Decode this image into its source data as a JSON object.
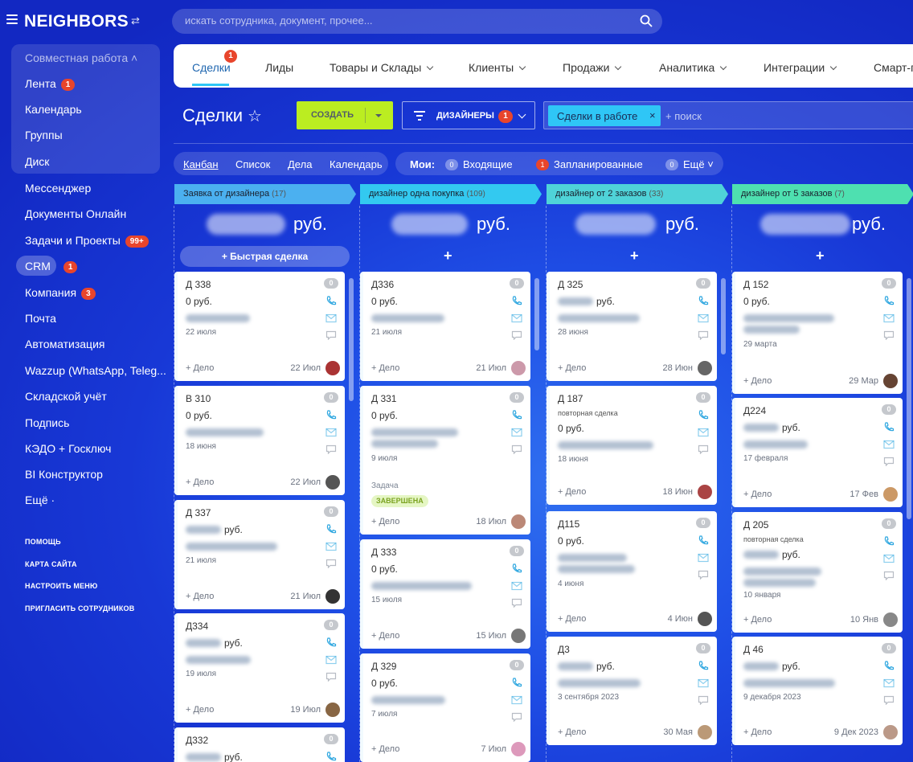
{
  "app": {
    "logo": "NEIGHBORS",
    "swap_icon": "swap-icon"
  },
  "search": {
    "placeholder": "искать сотрудника, документ, прочее..."
  },
  "sidebar": {
    "group": "Совместная работа",
    "items": [
      {
        "label": "Лента",
        "badge": "1"
      },
      {
        "label": "Календарь"
      },
      {
        "label": "Группы"
      },
      {
        "label": "Диск"
      },
      {
        "label": "Мессенджер"
      },
      {
        "label": "Документы Онлайн"
      },
      {
        "label": "Задачи и Проекты",
        "badge": "99+"
      },
      {
        "label": "CRM",
        "badge": "1"
      },
      {
        "label": "Компания",
        "badge": "3"
      },
      {
        "label": "Почта"
      },
      {
        "label": "Автоматизация"
      },
      {
        "label": "Wazzup (WhatsApp, Teleg..."
      },
      {
        "label": "Складской учёт"
      },
      {
        "label": "Подпись"
      },
      {
        "label": "КЭДО + Госключ"
      },
      {
        "label": "BI Конструктор"
      },
      {
        "label": "Ещё ·"
      }
    ],
    "small": [
      "ПОМОЩЬ",
      "КАРТА САЙТА",
      "НАСТРОИТЬ МЕНЮ",
      "ПРИГЛАСИТЬ СОТРУДНИКОВ"
    ]
  },
  "tabs": [
    {
      "label": "Сделки",
      "badge": "1"
    },
    {
      "label": "Лиды"
    },
    {
      "label": "Товары и Склады"
    },
    {
      "label": "Клиенты"
    },
    {
      "label": "Продажи"
    },
    {
      "label": "Аналитика"
    },
    {
      "label": "Интеграции"
    },
    {
      "label": "Смарт-п"
    }
  ],
  "page": {
    "title": "Сделки",
    "create": "СОЗДАТЬ",
    "filter": "ДИЗАЙНЕРЫ",
    "filter_count": "1",
    "chip": "Сделки в работе",
    "chip_close": "×",
    "search_ph": "+ поиск"
  },
  "views": [
    "Канбан",
    "Список",
    "Дела",
    "Календарь"
  ],
  "mine": {
    "label": "Мои:",
    "incoming_count": "0",
    "incoming": "Входящие",
    "planned_count": "1",
    "planned": "Запланированные",
    "more_count": "0",
    "more": "Ещё"
  },
  "quick_deal": "+ Быстрая сделка",
  "plus": "+",
  "currency": "руб.",
  "columns": [
    {
      "name": "Заявка от дизайнера",
      "count": "(17)",
      "color": "#4bb0f0",
      "cards": [
        {
          "title": "Д 338",
          "badge": "0",
          "amount": "0 руб.",
          "date": "22 июля",
          "add": "+ Дело",
          "when": "22 Июл"
        },
        {
          "title": "В 310",
          "badge": "0",
          "amount": "0 руб.",
          "date": "18 июня",
          "add": "+ Дело",
          "when": "22 Июл"
        },
        {
          "title": "Д 337",
          "badge": "0",
          "amount": "руб.",
          "date": "21 июля",
          "add": "+ Дело",
          "when": "21 Июл"
        },
        {
          "title": "Д334",
          "badge": "0",
          "amount": "руб.",
          "date": "19 июля",
          "add": "+ Дело",
          "when": "19 Июл"
        },
        {
          "title": "Д332",
          "badge": "0",
          "amount": "руб."
        }
      ]
    },
    {
      "name": "дизайнер одна покупка",
      "count": "(109)",
      "color": "#33c9f0",
      "cards": [
        {
          "title": "Д336",
          "badge": "0",
          "amount": "0 руб.",
          "date": "21 июля",
          "add": "+ Дело",
          "when": "21 Июл"
        },
        {
          "title": "Д 331",
          "badge": "0",
          "amount": "0 руб.",
          "date": "9 июля",
          "task": "Задача",
          "status": "ЗАВЕРШЕНА",
          "add": "+ Дело",
          "when": "18 Июл"
        },
        {
          "title": "Д 333",
          "badge": "0",
          "amount": "0 руб.",
          "date": "15 июля",
          "add": "+ Дело",
          "when": "15 Июл"
        },
        {
          "title": "Д 329",
          "badge": "0",
          "amount": "0 руб.",
          "date": "7 июля",
          "add": "+ Дело",
          "when": "7 Июл"
        }
      ]
    },
    {
      "name": "дизайнер от 2 заказов",
      "count": "(33)",
      "color": "#4fd3d8",
      "cards": [
        {
          "title": "Д 325",
          "badge": "0",
          "amount": "руб.",
          "date": "28 июня",
          "add": "+ Дело",
          "when": "28 Июн"
        },
        {
          "title": "Д 187",
          "badge": "0",
          "sub": "повторная сделка",
          "amount": "0 руб.",
          "date": "18 июня",
          "add": "+ Дело",
          "when": "18 Июн"
        },
        {
          "title": "Д115",
          "badge": "0",
          "amount": "0 руб.",
          "date": "4 июня",
          "add": "+ Дело",
          "when": "4 Июн"
        },
        {
          "title": "Д3",
          "badge": "0",
          "amount": "руб.",
          "date": "3 сентября 2023",
          "add": "+ Дело",
          "when": "30 Мая"
        }
      ]
    },
    {
      "name": "дизайнер от 5 заказов",
      "count": "(7)",
      "color": "#4ee0b0",
      "cards": [
        {
          "title": "Д 152",
          "badge": "0",
          "amount": "0 руб.",
          "date": "29 марта",
          "add": "+ Дело",
          "when": "29 Мар"
        },
        {
          "title": "Д224",
          "badge": "0",
          "amount": "руб.",
          "date": "17 февраля",
          "add": "+ Дело",
          "when": "17 Фев"
        },
        {
          "title": "Д 205",
          "badge": "0",
          "sub": "повторная сделка",
          "amount": "руб.",
          "date": "10 января",
          "add": "+ Дело",
          "when": "10 Янв"
        },
        {
          "title": "Д 46",
          "badge": "0",
          "amount": "руб.",
          "date": "9 декабря 2023",
          "add": "+ Дело",
          "when": "9 Дек 2023"
        }
      ]
    }
  ],
  "colors": {
    "accent": "#2fc6f6",
    "create": "#bbed21",
    "badge": "#e8452c"
  }
}
